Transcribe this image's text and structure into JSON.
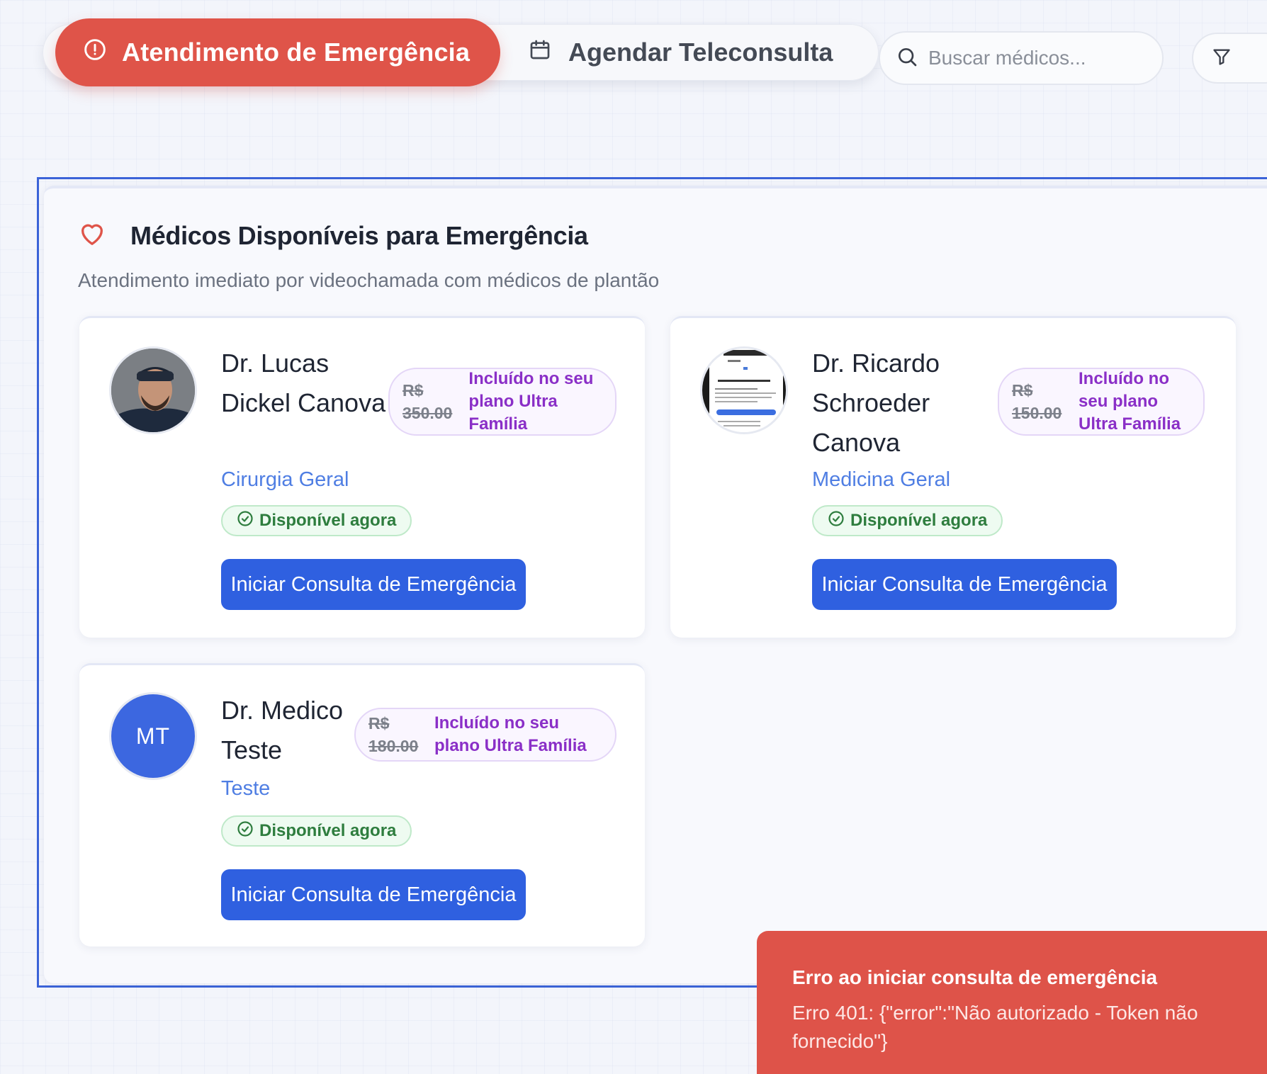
{
  "tabs": {
    "emergency_label": "Atendimento de Emergência",
    "schedule_label": "Agendar Teleconsulta"
  },
  "search": {
    "placeholder": "Buscar médicos..."
  },
  "section": {
    "title": "Médicos Disponíveis para Emergência",
    "subtitle": "Atendimento imediato por videochamada com médicos de plantão"
  },
  "doctors": [
    {
      "name": "Dr. Lucas Dickel Canova",
      "specialty": "Cirurgia Geral",
      "old_price": "R$ 350.00",
      "plan": "Incluído no seu plano Ultra Família",
      "status": "Disponível agora",
      "cta": "Iniciar Consulta de Emergência",
      "avatar": "photo"
    },
    {
      "name": "Dr. Ricardo Schroeder Canova",
      "specialty": "Medicina Geral",
      "old_price": "R$ 150.00",
      "plan": "Incluído no seu plano Ultra Família",
      "status": "Disponível agora",
      "cta": "Iniciar Consulta de Emergência",
      "avatar": "screenshot"
    },
    {
      "name": "Dr. Medico Teste",
      "specialty": "Teste",
      "old_price": "R$ 180.00",
      "plan": "Incluído no seu plano Ultra Família",
      "status": "Disponível agora",
      "cta": "Iniciar Consulta de Emergência",
      "avatar_initials": "MT"
    }
  ],
  "toast": {
    "title": "Erro ao iniciar consulta de emergência",
    "message": "Erro 401: {\"error\":\"Não autorizado - Token não fornecido\"}"
  },
  "colors": {
    "emergency": "#df5449",
    "primary": "#2f60e0",
    "available": "#2e7d3e",
    "plan": "#8a2fc7"
  },
  "icons": {
    "emergency_tab": "alert-circle-icon",
    "schedule_tab": "calendar-icon",
    "search": "search-icon",
    "filter": "filter-icon",
    "section": "heart-icon",
    "available": "check-circle-icon"
  }
}
